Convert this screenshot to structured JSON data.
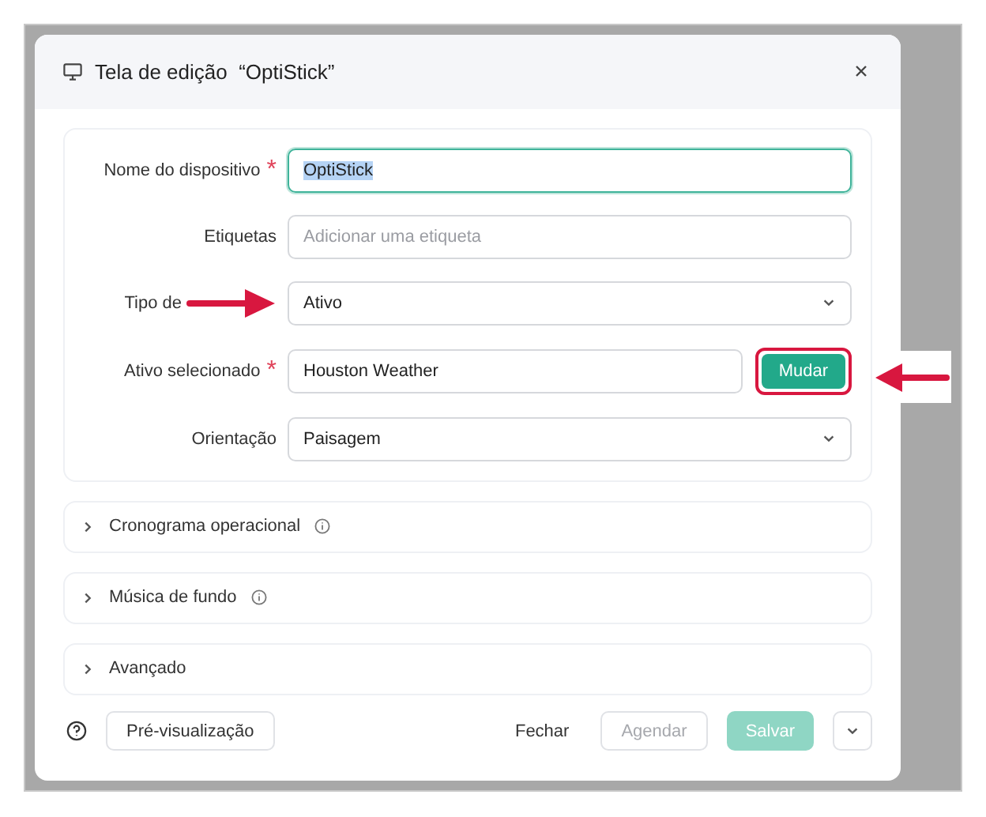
{
  "dialog": {
    "title": "Tela de edição  “OptiStick”"
  },
  "form": [
    {
      "kind": "text",
      "label": "Nome do dispositivo",
      "required_mark": "*",
      "value": "OptiStick",
      "focused": true,
      "text_selected": true
    },
    {
      "kind": "text",
      "label": "Etiquetas",
      "placeholder": "Adicionar uma etiqueta",
      "focused": false
    },
    {
      "kind": "select",
      "label": "Tipo de",
      "value": "Ativo",
      "focused": false,
      "arrow_callout": true
    },
    {
      "kind": "text_with_button",
      "label": "Ativo selecionado",
      "required_mark": "*",
      "value": "Houston Weather",
      "button": "Mudar",
      "focused": false
    },
    {
      "kind": "select",
      "label": "Orientação",
      "value": "Paisagem",
      "focused": false
    }
  ],
  "sections": [
    {
      "title": "Cronograma operacional",
      "info": true,
      "expanded": false
    },
    {
      "title": "Música de fundo",
      "info": true,
      "expanded": false
    },
    {
      "title": "Avançado",
      "info": false,
      "expanded": false
    }
  ],
  "footer": {
    "preview": "Pré-visualização",
    "buttons": [
      {
        "kind": "text",
        "label": "Fechar",
        "disabled": false
      },
      {
        "kind": "outline",
        "label": "Agendar",
        "disabled": true
      },
      {
        "kind": "primary",
        "label": "Salvar",
        "disabled": true
      }
    ]
  }
}
